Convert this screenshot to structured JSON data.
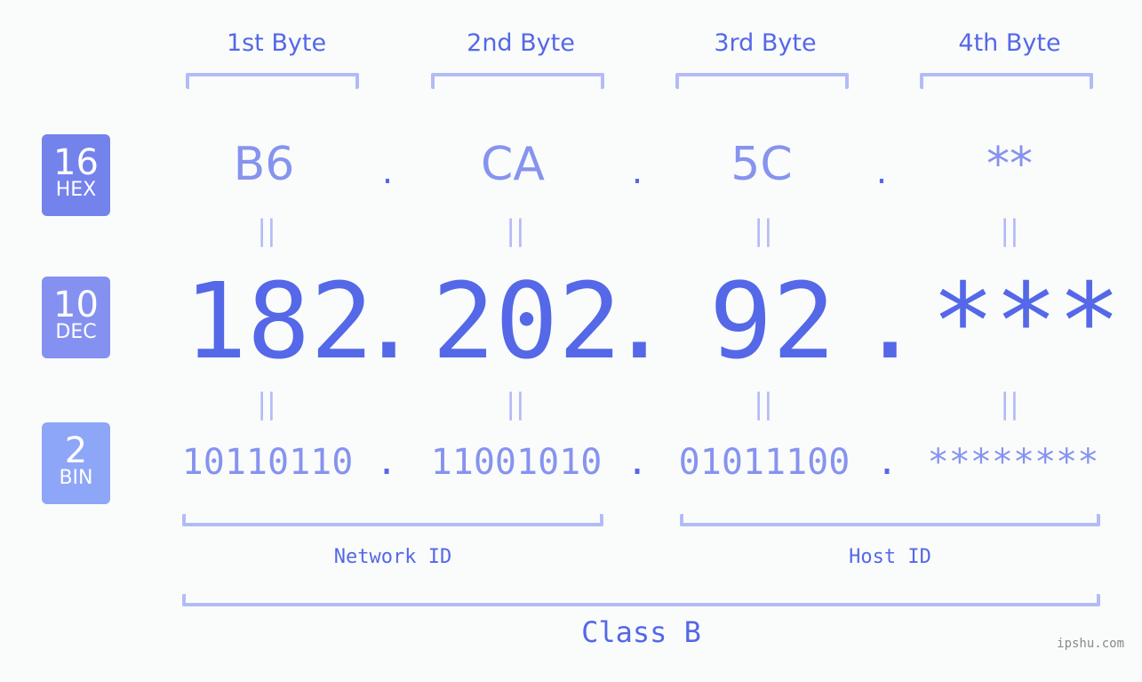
{
  "headers": [
    "1st Byte",
    "2nd Byte",
    "3rd Byte",
    "4th Byte"
  ],
  "badges": [
    {
      "num": "16",
      "label": "HEX",
      "color": "#7482ec"
    },
    {
      "num": "10",
      "label": "DEC",
      "color": "#8491f0"
    },
    {
      "num": "2",
      "label": "BIN",
      "color": "#8ea6f8"
    }
  ],
  "hex": [
    "B6",
    "CA",
    "5C",
    "**"
  ],
  "dec": [
    "182",
    "202",
    "92",
    "***"
  ],
  "bin": [
    "10110110",
    "11001010",
    "01011100",
    "********"
  ],
  "separator": ".",
  "equals": "=",
  "network_id": "Network ID",
  "host_id": "Host ID",
  "class_label": "Class B",
  "watermark": "ipshu.com",
  "colors": {
    "accent": "#5468e8",
    "light": "#8693ef",
    "bracket": "#b3bbf7"
  }
}
